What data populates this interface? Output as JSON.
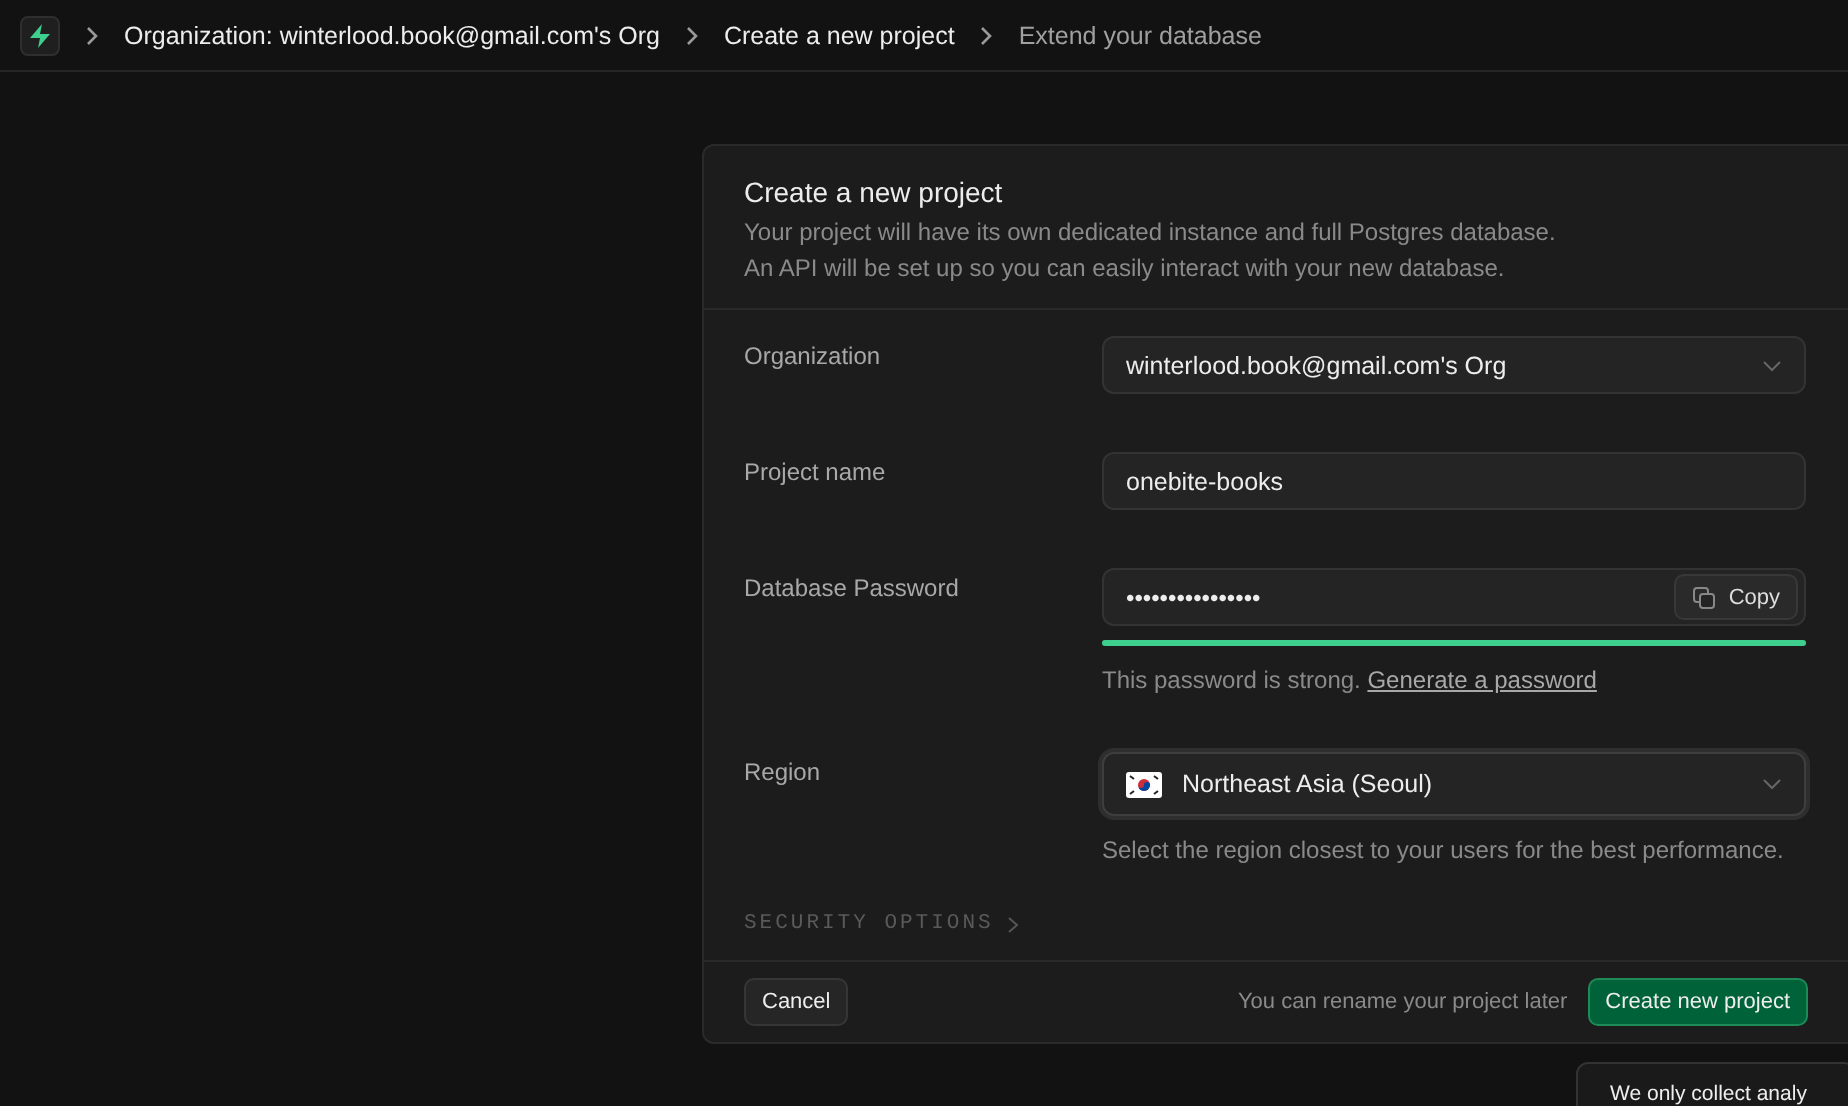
{
  "breadcrumb": [
    {
      "label": "Organization: winterlood.book@gmail.com's Org",
      "kind": "link"
    },
    {
      "label": "Create a new project",
      "kind": "link"
    },
    {
      "label": "Extend your database",
      "kind": "current"
    }
  ],
  "card": {
    "title": "Create a new project",
    "description": [
      "Your project will have its own dedicated instance and full Postgres database.",
      "An API will be set up so you can easily interact with your new database."
    ]
  },
  "fields": [
    {
      "label": "Organization",
      "kind": "select",
      "value": "winterlood.book@gmail.com's Org"
    },
    {
      "label": "Project name",
      "kind": "text",
      "value": "onebite-books"
    },
    {
      "label": "Database Password",
      "kind": "password",
      "value": "••••••••••••••••",
      "copy_label": "Copy",
      "level": 1,
      "helper": "This password is strong.",
      "helper_link": "Generate a password"
    },
    {
      "label": "Region",
      "kind": "region",
      "value": "Northeast Asia (Seoul)",
      "focused": true,
      "helper": "Select the region closest to your users for the best performance."
    }
  ],
  "security_options": {
    "label": "SECURITY OPTIONS",
    "expanded": false
  },
  "footer": {
    "cancel": "Cancel",
    "note": "You can rename your project later",
    "submit": "Create new project"
  },
  "toast": {
    "text": "We only collect analy"
  }
}
